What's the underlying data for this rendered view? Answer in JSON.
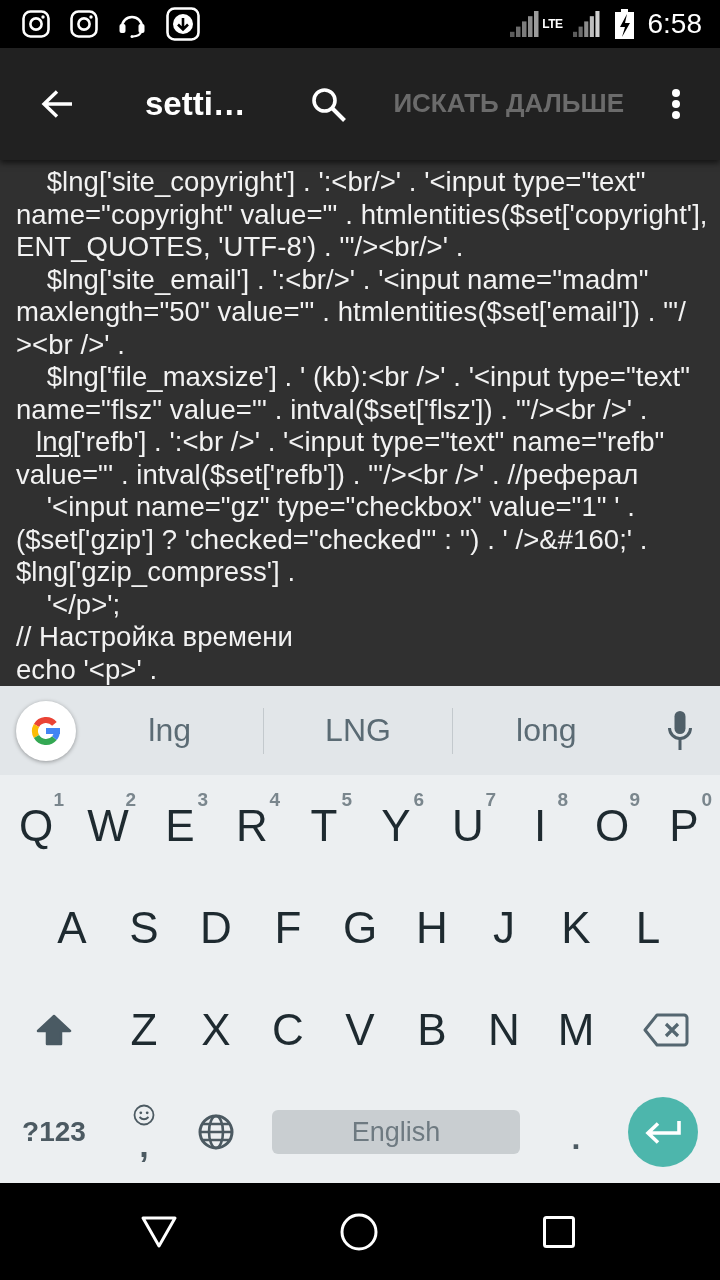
{
  "status_bar": {
    "network_type": "LTE",
    "time": "6:58"
  },
  "toolbar": {
    "title": "setti…",
    "find_next": {
      "label": "ИСКАТЬ ДАЛЬШЕ",
      "disabled": true
    }
  },
  "editor": {
    "lines": [
      {
        "kind": "plain",
        "text": "    $lng['site_copyright'] . ':<br/>' . '<input type=\"text\""
      },
      {
        "kind": "plain",
        "text": "name=\"copyright\" value=\"' . htmlentities($set['copyright'],"
      },
      {
        "kind": "plain",
        "text": "ENT_QUOTES, 'UTF-8') . '\"/><br/>' ."
      },
      {
        "kind": "plain",
        "text": "    $lng['site_email'] . ':<br/>' . '<input name=\"madm\""
      },
      {
        "kind": "plain",
        "text": "maxlength=\"50\" value=\"' . htmlentities($set['email']) . '\"/"
      },
      {
        "kind": "plain",
        "text": "><br />' ."
      },
      {
        "kind": "plain",
        "text": "    $lng['file_maxsize'] . ' (kb):<br />' . '<input type=\"text\""
      },
      {
        "kind": "plain",
        "text": "name=\"flsz\" value=\"' . intval($set['flsz']) . '\"/><br />' ."
      },
      {
        "kind": "composing",
        "composing": "lng",
        "after": "['refb'] . ':<br />' . '<input type=\"text\" name=\"refb\""
      },
      {
        "kind": "plain",
        "text": "value=\"' . intval($set['refb']) . '\"/><br />' . //реферал"
      },
      {
        "kind": "plain",
        "text": "    '<input name=\"gz\" type=\"checkbox\" value=\"1\" ' ."
      },
      {
        "kind": "plain",
        "text": "($set['gzip'] ? 'checked=\"checked\"' : '') . ' />&#160;' ."
      },
      {
        "kind": "plain",
        "text": "$lng['gzip_compress'] ."
      },
      {
        "kind": "plain",
        "text": "    '</p>';"
      },
      {
        "kind": "plain",
        "text": "// Настройка времени"
      },
      {
        "kind": "plain",
        "text": "echo '<p>' ."
      }
    ]
  },
  "keyboard": {
    "suggestions": [
      "lng",
      "LNG",
      "long"
    ],
    "rows": [
      {
        "keys": [
          {
            "kind": "letter",
            "label": "Q",
            "hint": "1"
          },
          {
            "kind": "letter",
            "label": "W",
            "hint": "2"
          },
          {
            "kind": "letter",
            "label": "E",
            "hint": "3"
          },
          {
            "kind": "letter",
            "label": "R",
            "hint": "4"
          },
          {
            "kind": "letter",
            "label": "T",
            "hint": "5"
          },
          {
            "kind": "letter",
            "label": "Y",
            "hint": "6"
          },
          {
            "kind": "letter",
            "label": "U",
            "hint": "7"
          },
          {
            "kind": "letter",
            "label": "I",
            "hint": "8"
          },
          {
            "kind": "letter",
            "label": "O",
            "hint": "9"
          },
          {
            "kind": "letter",
            "label": "P",
            "hint": "0"
          }
        ]
      },
      {
        "keys": [
          {
            "kind": "letter",
            "label": "A"
          },
          {
            "kind": "letter",
            "label": "S"
          },
          {
            "kind": "letter",
            "label": "D"
          },
          {
            "kind": "letter",
            "label": "F"
          },
          {
            "kind": "letter",
            "label": "G"
          },
          {
            "kind": "letter",
            "label": "H"
          },
          {
            "kind": "letter",
            "label": "J"
          },
          {
            "kind": "letter",
            "label": "K"
          },
          {
            "kind": "letter",
            "label": "L"
          }
        ]
      },
      {
        "keys": [
          {
            "kind": "shift",
            "on": true
          },
          {
            "kind": "letter",
            "label": "Z"
          },
          {
            "kind": "letter",
            "label": "X"
          },
          {
            "kind": "letter",
            "label": "C"
          },
          {
            "kind": "letter",
            "label": "V"
          },
          {
            "kind": "letter",
            "label": "B"
          },
          {
            "kind": "letter",
            "label": "N"
          },
          {
            "kind": "letter",
            "label": "M"
          },
          {
            "kind": "backspace"
          }
        ]
      },
      {
        "keys": [
          {
            "kind": "symbols",
            "label": "?123"
          },
          {
            "kind": "comma",
            "label": ","
          },
          {
            "kind": "globe"
          },
          {
            "kind": "space",
            "label": "English"
          },
          {
            "kind": "period",
            "label": "."
          },
          {
            "kind": "enter"
          }
        ]
      }
    ]
  }
}
